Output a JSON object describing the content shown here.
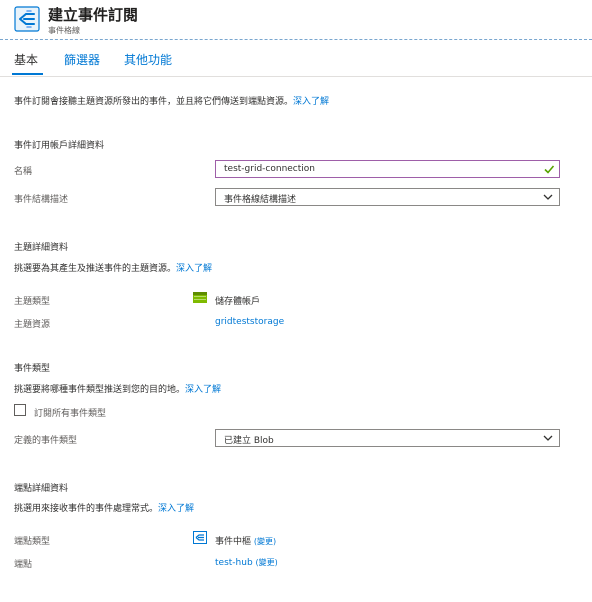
{
  "header": {
    "title": "建立事件訂閱",
    "subtitle": "事件格線"
  },
  "tabs": [
    {
      "label": "基本",
      "active": true
    },
    {
      "label": "篩選器",
      "active": false
    },
    {
      "label": "其他功能",
      "active": false
    }
  ],
  "intro": {
    "text": "事件訂閱會接聽主題資源所發出的事件，並且將它們傳送到端點資源。",
    "link": "深入了解"
  },
  "subscription": {
    "section_title": "事件訂用帳戶詳細資料",
    "name_label": "名稱",
    "name_value": "test-grid-connection",
    "schema_label": "事件結構描述",
    "schema_value": "事件格線結構描述"
  },
  "topic": {
    "section_title": "主題詳細資料",
    "desc": "挑選要為其產生及推送事件的主題資源。",
    "link": "深入了解",
    "type_label": "主題類型",
    "type_value": "儲存體帳戶",
    "resource_label": "主題資源",
    "resource_value": "gridteststorage"
  },
  "event_types": {
    "section_title": "事件類型",
    "desc": "挑選要將哪種事件類型推送到您的目的地。",
    "link": "深入了解",
    "subscribe_all_label": "訂閱所有事件類型",
    "subscribe_all_checked": false,
    "defined_label": "定義的事件類型",
    "defined_value": "已建立 Blob"
  },
  "endpoint": {
    "section_title": "端點詳細資料",
    "desc": "挑選用來接收事件的事件處理常式。",
    "link": "深入了解",
    "type_label": "端點類型",
    "type_value": "事件中樞",
    "type_change": "(變更)",
    "endpoint_label": "端點",
    "endpoint_value": "test-hub",
    "endpoint_change": "(變更)"
  },
  "colors": {
    "accent": "#0078d4",
    "valid_check": "#57a300",
    "focus_border": "#9e5fa8"
  },
  "icons": [
    "event-grid-icon",
    "checkmark-icon",
    "chevron-down-icon",
    "storage-account-icon",
    "event-hub-icon"
  ]
}
